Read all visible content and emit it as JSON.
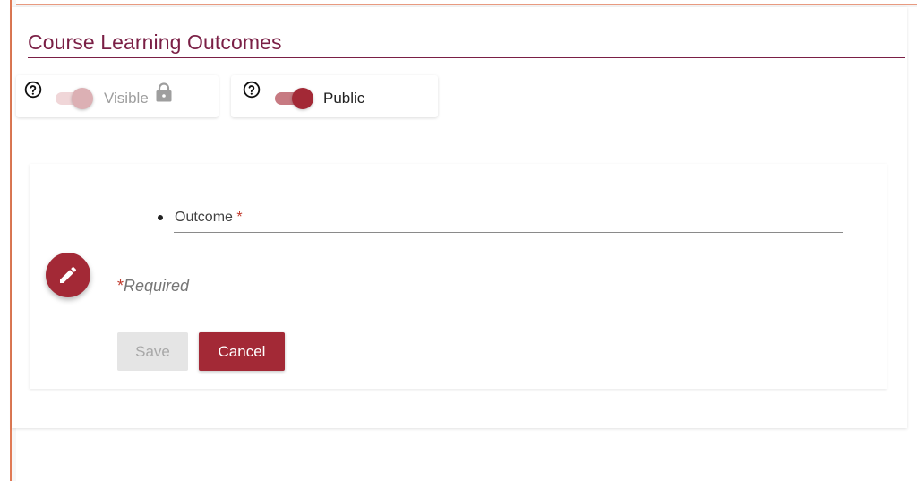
{
  "page": {
    "title": "Course Learning Outcomes"
  },
  "toggles": {
    "visible": {
      "label": "Visible",
      "state": "on",
      "disabled": true,
      "locked": true,
      "help_icon": "help-circle-icon",
      "lock_icon": "lock-icon"
    },
    "public": {
      "label": "Public",
      "state": "on",
      "disabled": false,
      "help_icon": "help-circle-icon"
    }
  },
  "form": {
    "outcome_label": "Outcome",
    "required_marker": "*",
    "outcome_value": "",
    "required_note": "Required",
    "edit_icon": "pencil-icon",
    "save_label": "Save",
    "cancel_label": "Cancel"
  },
  "colors": {
    "brand": "#a32936",
    "title": "#7a1f45",
    "accent_border": "#e07a55"
  }
}
